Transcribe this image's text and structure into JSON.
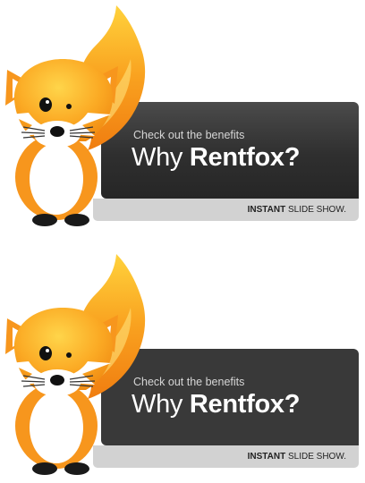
{
  "banners": [
    {
      "subtitle": "Check out the benefits",
      "title_prefix": "Why ",
      "title_brand": "Rentfox?",
      "strip_bold": "INSTANT",
      "strip_rest": " SLIDE SHOW."
    },
    {
      "subtitle": "Check out the benefits",
      "title_prefix": "Why ",
      "title_brand": "Rentfox?",
      "strip_bold": "INSTANT",
      "strip_rest": " SLIDE SHOW."
    }
  ],
  "colors": {
    "fox_orange": "#f7931e",
    "fox_light": "#ffc64a",
    "fox_white": "#ffffff",
    "panel_dark": "#333333",
    "strip_gray": "#d2d2d2"
  }
}
